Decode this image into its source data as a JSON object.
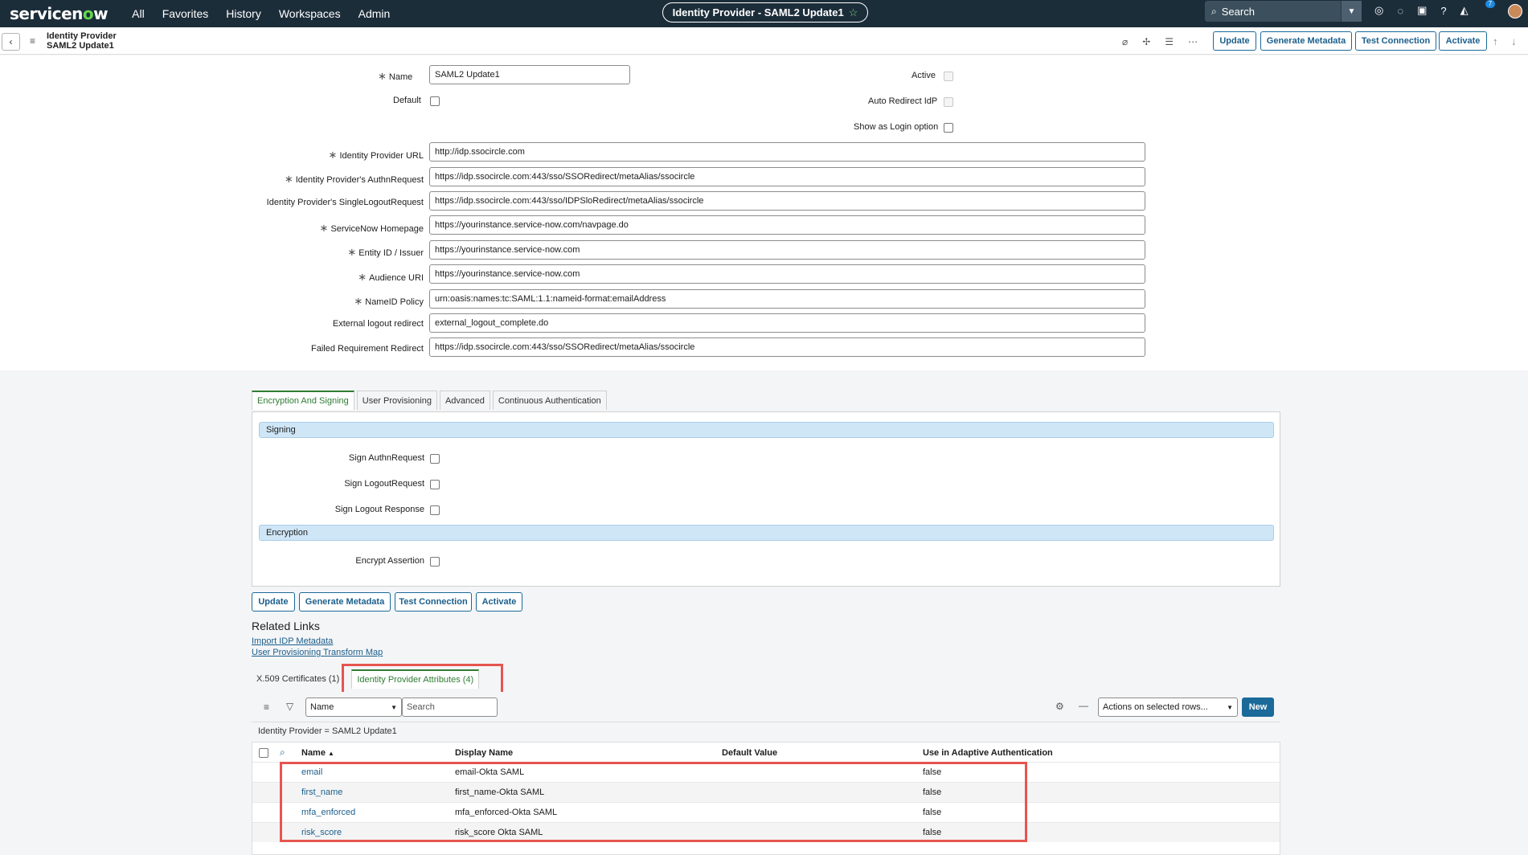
{
  "topnav": {
    "logo_a": "servicen",
    "logo_o": "o",
    "logo_b": "w",
    "links": [
      "All",
      "Favorites",
      "History",
      "Workspaces",
      "Admin"
    ],
    "title_pill": "Identity Provider - SAML2 Update1",
    "search_label": "Search",
    "notification_count": "7"
  },
  "record_header": {
    "line1": "Identity Provider",
    "line2": "SAML2 Update1",
    "buttons": {
      "update": "Update",
      "generate_metadata": "Generate Metadata",
      "test_connection": "Test Connection",
      "activate": "Activate"
    }
  },
  "form": {
    "name_label": "Name",
    "name_value": "SAML2 Update1",
    "default_label": "Default",
    "active_label": "Active",
    "auto_redirect_label": "Auto Redirect IdP",
    "show_login_label": "Show as Login option",
    "fields": [
      {
        "label": "Identity Provider URL",
        "required": true,
        "value": "http://idp.ssocircle.com"
      },
      {
        "label": "Identity Provider's AuthnRequest",
        "required": true,
        "value": "https://idp.ssocircle.com:443/sso/SSORedirect/metaAlias/ssocircle"
      },
      {
        "label": "Identity Provider's SingleLogoutRequest",
        "required": false,
        "value": "https://idp.ssocircle.com:443/sso/IDPSloRedirect/metaAlias/ssocircle"
      },
      {
        "label": "ServiceNow Homepage",
        "required": true,
        "value": "https://yourinstance.service-now.com/navpage.do"
      },
      {
        "label": "Entity ID / Issuer",
        "required": true,
        "value": "https://yourinstance.service-now.com"
      },
      {
        "label": "Audience URI",
        "required": true,
        "value": "https://yourinstance.service-now.com"
      },
      {
        "label": "NameID Policy",
        "required": true,
        "value": "urn:oasis:names:tc:SAML:1.1:nameid-format:emailAddress"
      },
      {
        "label": "External logout redirect",
        "required": false,
        "value": "external_logout_complete.do"
      },
      {
        "label": "Failed Requirement Redirect",
        "required": false,
        "value": "https://idp.ssocircle.com:443/sso/SSORedirect/metaAlias/ssocircle"
      }
    ]
  },
  "section_tabs": [
    "Encryption And Signing",
    "User Provisioning",
    "Advanced",
    "Continuous Authentication"
  ],
  "signing": {
    "header": "Signing",
    "items": [
      "Sign AuthnRequest",
      "Sign LogoutRequest",
      "Sign Logout Response"
    ]
  },
  "encryption": {
    "header": "Encryption",
    "items": [
      "Encrypt Assertion"
    ]
  },
  "bottom_buttons": {
    "update": "Update",
    "generate_metadata": "Generate Metadata",
    "test_connection": "Test Connection",
    "activate": "Activate"
  },
  "related_links": {
    "title": "Related Links",
    "links": [
      "Import IDP Metadata",
      "User Provisioning Transform Map"
    ]
  },
  "related_tabs": [
    "X.509 Certificates (1)",
    "Identity Provider Attributes (4)"
  ],
  "list": {
    "field_select": "Name",
    "search_placeholder": "Search",
    "actions_select": "Actions on selected rows...",
    "new_button": "New",
    "filter_text": "Identity Provider = SAML2 Update1",
    "columns": [
      "Name",
      "Display Name",
      "Default Value",
      "Use in Adaptive Authentication"
    ],
    "rows": [
      {
        "name": "email",
        "display": "email-Okta SAML",
        "default": "",
        "adaptive": "false"
      },
      {
        "name": "first_name",
        "display": "first_name-Okta SAML",
        "default": "",
        "adaptive": "false"
      },
      {
        "name": "mfa_enforced",
        "display": "mfa_enforced-Okta SAML",
        "default": "",
        "adaptive": "false"
      },
      {
        "name": "risk_score",
        "display": "risk_score Okta SAML",
        "default": "",
        "adaptive": "false"
      }
    ]
  },
  "colors": {
    "nav_bg": "#1c2d3a",
    "brand_green": "#62d84e",
    "button_blue": "#1b5f8c",
    "highlight_red": "#e6554f",
    "section_blue": "#cfe6f7",
    "active_tab_green": "#2e7d32"
  }
}
